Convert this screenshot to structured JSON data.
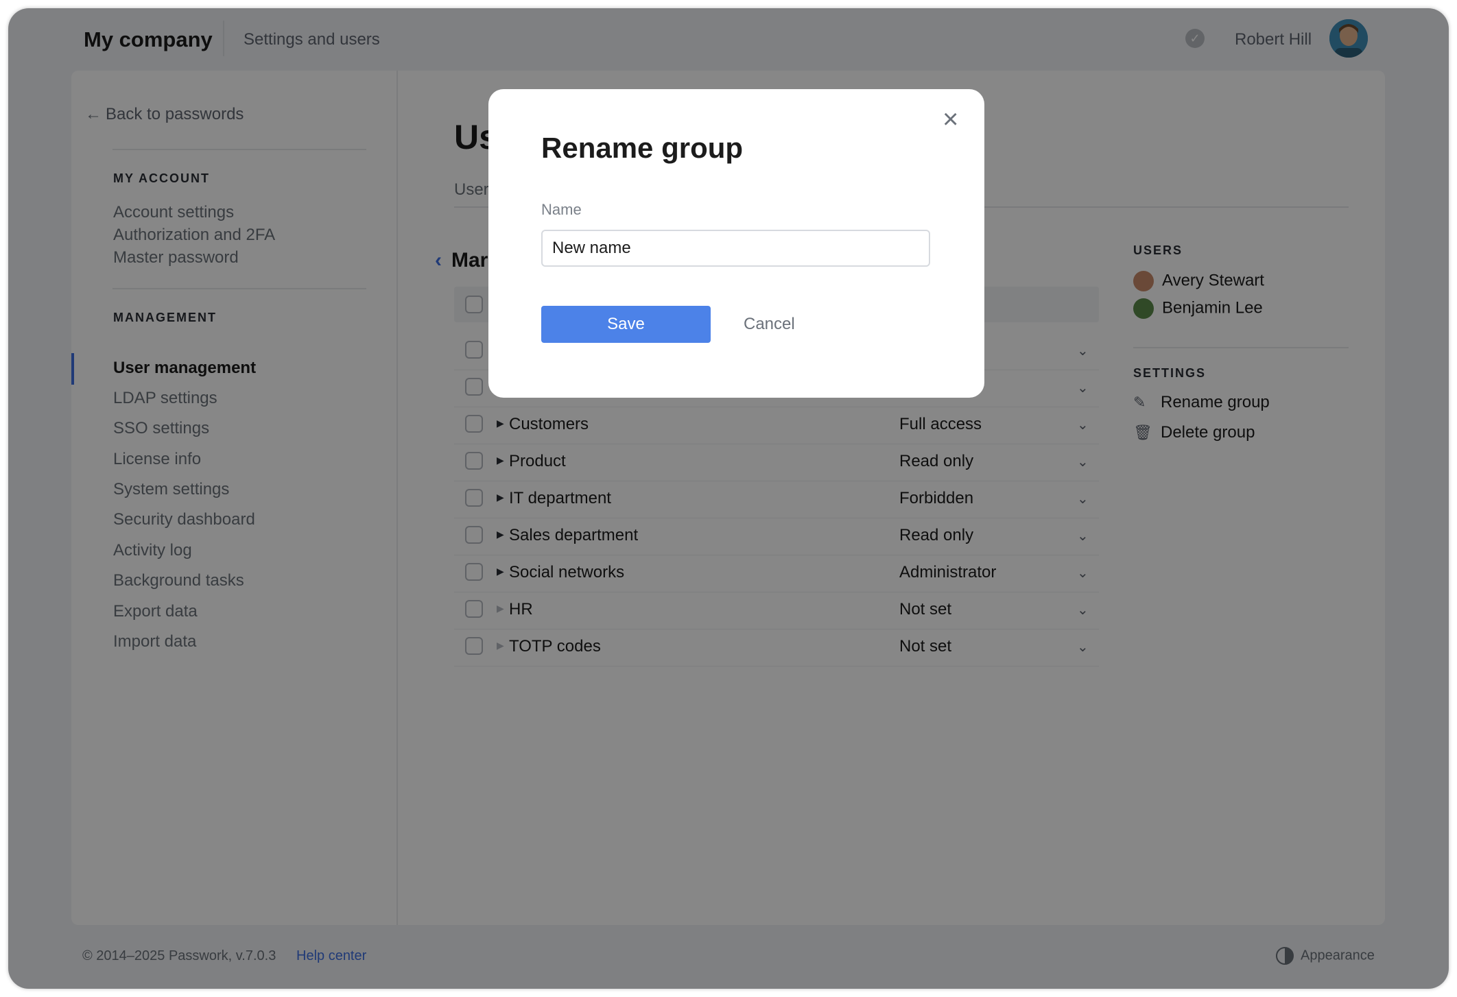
{
  "header": {
    "brand": "My company",
    "breadcrumb": "Settings and users",
    "username": "Robert Hill",
    "verified_icon": "check-circle-icon"
  },
  "sidebar": {
    "back_label": "Back to passwords",
    "sections": [
      {
        "title": "MY ACCOUNT",
        "items": [
          "Account settings",
          "Authorization and 2FA",
          "Master password"
        ]
      },
      {
        "title": "MANAGEMENT",
        "items": [
          "User management",
          "LDAP settings",
          "SSO settings",
          "License info",
          "System settings",
          "Security dashboard",
          "Activity log",
          "Background tasks",
          "Export data",
          "Import data"
        ]
      }
    ],
    "active_item": "User management"
  },
  "main": {
    "title_visible": "Us",
    "tab_visible": "User",
    "group_back_visible": "Mar",
    "rows": [
      {
        "name": "Customers",
        "access": "Full access",
        "expandable": true
      },
      {
        "name": "Product",
        "access": "Read only",
        "expandable": true
      },
      {
        "name": "IT department",
        "access": "Forbidden",
        "expandable": true
      },
      {
        "name": "Sales department",
        "access": "Read only",
        "expandable": true
      },
      {
        "name": "Social networks",
        "access": "Administrator",
        "expandable": true
      },
      {
        "name": "HR",
        "access": "Not set",
        "expandable": false
      },
      {
        "name": "TOTP codes",
        "access": "Not set",
        "expandable": false
      }
    ]
  },
  "right_panel": {
    "users_title": "USERS",
    "users": [
      "Avery Stewart",
      "Benjamin Lee"
    ],
    "settings_title": "SETTINGS",
    "actions": [
      {
        "label": "Rename group",
        "icon": "edit-icon"
      },
      {
        "label": "Delete group",
        "icon": "trash-icon"
      }
    ]
  },
  "modal": {
    "title": "Rename group",
    "field_label": "Name",
    "field_value": "New name",
    "save_label": "Save",
    "cancel_label": "Cancel"
  },
  "footer": {
    "copyright": "© 2014–2025 Passwork, v.7.0.3",
    "help_label": "Help center",
    "appearance_label": "Appearance"
  },
  "colors": {
    "accent": "#4c82e8",
    "link": "#3d6fe0",
    "overlay": "rgba(0,0,0,0.47)"
  }
}
